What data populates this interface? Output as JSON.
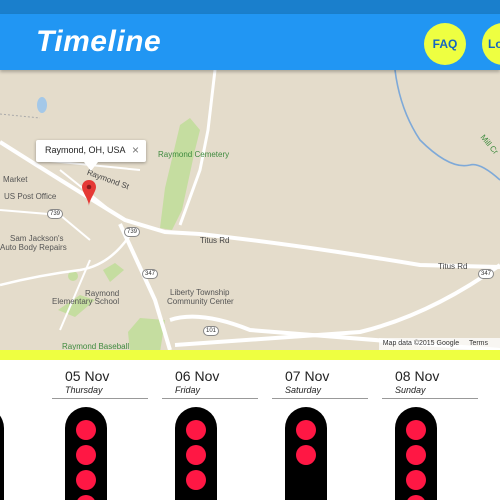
{
  "header": {
    "title": "Timeline",
    "faq_label": "FAQ",
    "login_label": "Lo",
    "bg_color": "#2196f3",
    "button_color": "#eeff41"
  },
  "map": {
    "info_window": {
      "text": "Raymond, OH, USA",
      "close": "×"
    },
    "labels": {
      "raymond_st": "Raymond St",
      "raymond_cemetery": "Raymond Cemetery",
      "market": "Market",
      "us_post_office": "US Post Office",
      "sam_jackson_1": "Sam Jackson's",
      "sam_jackson_2": "Auto Body Repairs",
      "titus_rd_1": "Titus Rd",
      "titus_rd_2": "Titus Rd",
      "mill_cr": "Mill Cr",
      "raymond_school_1": "Raymond",
      "raymond_school_2": "Elementary School",
      "liberty_1": "Liberty Township",
      "liberty_2": "Community Center",
      "raymond_baseball": "Raymond Baseball"
    },
    "shields": {
      "r739a": "739",
      "r739b": "739",
      "r347a": "347",
      "r347b": "347",
      "r101": "101"
    },
    "attribution": {
      "data": "Map data ©2015 Google",
      "terms": "Terms"
    }
  },
  "timeline": {
    "days": [
      {
        "date": "05 Nov",
        "weekday": "Thursday",
        "dots": 4
      },
      {
        "date": "06 Nov",
        "weekday": "Friday",
        "dots": 3
      },
      {
        "date": "07 Nov",
        "weekday": "Saturday",
        "dots": 2
      },
      {
        "date": "08 Nov",
        "weekday": "Sunday",
        "dots": 4
      }
    ],
    "dot_color": "#ff1744"
  }
}
